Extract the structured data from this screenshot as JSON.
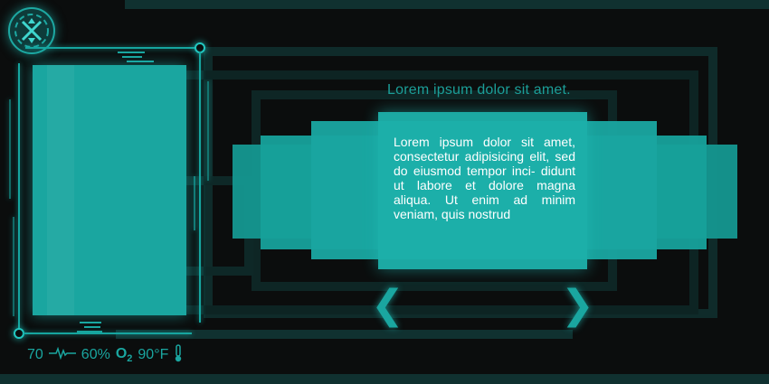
{
  "header": {
    "title": "Lorem ipsum dolor sit amet."
  },
  "content": {
    "body": "Lorem ipsum dolor sit amet, consectetur adipisicing elit, sed do eiusmod tempor inci- didunt ut labore et dolore magna aliqua. Ut enim ad minim veniam, quis nostrud"
  },
  "nav": {
    "prev_icon": "chevron-left-icon",
    "next_icon": "chevron-right-icon",
    "prev_glyph": "❮",
    "next_glyph": "❯"
  },
  "status": {
    "heart_rate": "70",
    "percent": "60%",
    "oxygen_label": "O",
    "oxygen_sub": "2",
    "temperature": "90°F"
  },
  "colors": {
    "accent": "#1aa6a0",
    "background": "#0b0d0d",
    "dark_outline": "#0f2b2a"
  },
  "icons": [
    "logo-emblem-icon",
    "heartbeat-icon",
    "thermometer-icon"
  ]
}
